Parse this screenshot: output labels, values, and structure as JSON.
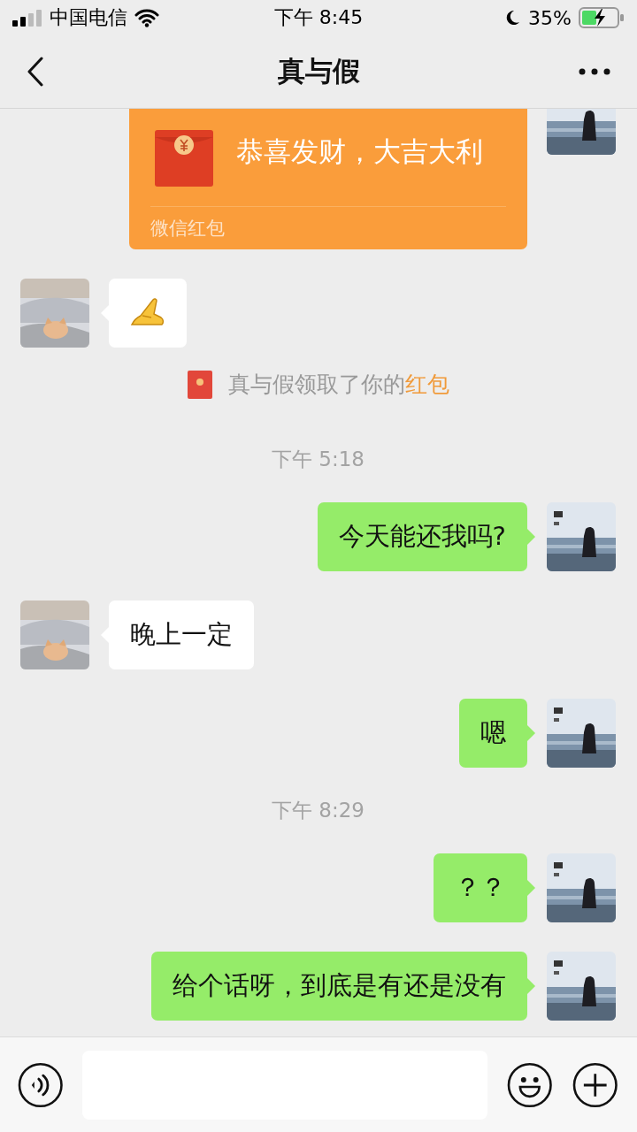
{
  "status_bar": {
    "carrier": "中国电信",
    "time": "下午 8:45",
    "battery": "35%"
  },
  "nav": {
    "title": "真与假"
  },
  "messages": [
    {
      "kind": "redpacket",
      "mine": true,
      "greeting": "恭喜发财，大吉大利",
      "label": "微信红包"
    },
    {
      "kind": "sticker",
      "mine": false
    },
    {
      "kind": "notice",
      "text": "真与假领取了你的",
      "link": "红包"
    },
    {
      "kind": "time",
      "text": "下午 5:18"
    },
    {
      "kind": "text",
      "mine": true,
      "text": "今天能还我吗?"
    },
    {
      "kind": "text",
      "mine": false,
      "text": "晚上一定"
    },
    {
      "kind": "text",
      "mine": true,
      "text": "嗯"
    },
    {
      "kind": "time",
      "text": "下午 8:29"
    },
    {
      "kind": "text",
      "mine": true,
      "text": "？？"
    },
    {
      "kind": "text",
      "mine": true,
      "text": "给个话呀，到底是有还是没有"
    }
  ]
}
